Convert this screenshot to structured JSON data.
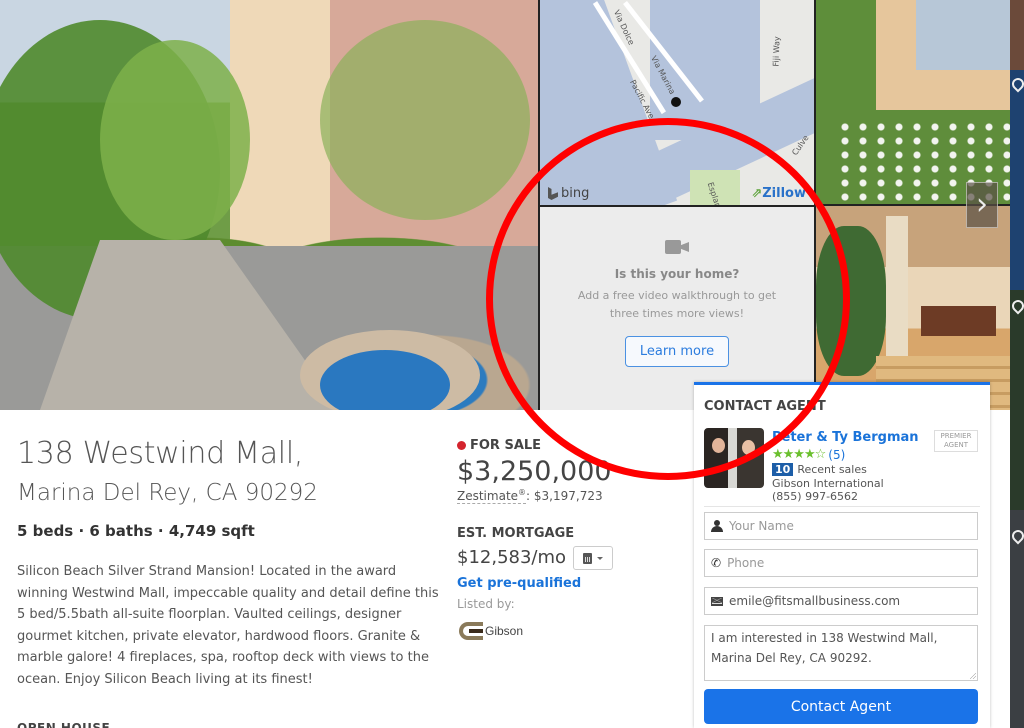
{
  "gallery": {
    "next_icon": "chevron-right-icon",
    "next_label": "›"
  },
  "map": {
    "streets": [
      "Via Dolce",
      "Via Marina",
      "Pacific Ave",
      "Fiji Way",
      "Esplan",
      "Culve"
    ],
    "provider": "bing",
    "brand": "Zillow",
    "brand_mark": "⇗"
  },
  "promo": {
    "icon": "video-camera-icon",
    "title": "Is this your home?",
    "description_line1": "Add a free video walkthrough to get",
    "description_line2": "three times more views!",
    "button_label": "Learn more"
  },
  "listing": {
    "address_line1": "138 Westwind Mall,",
    "address_line2": "Marina Del Rey, CA 90292",
    "facts": "5 beds · 6 baths · 4,749 sqft",
    "description": "Silicon Beach Silver Strand Mansion! Located in the award winning Westwind Mall, impeccable quality and detail define this 5 bed/5.5bath all-suite floorplan. Vaulted ceilings, designer gourmet kitchen, private elevator, hardwood floors. Granite & marble galore! 4 fireplaces, spa, rooftop deck with views to the ocean. Enjoy Silicon Beach living at its finest!",
    "open_house_heading": "OPEN HOUSE"
  },
  "pricing": {
    "status": "FOR SALE",
    "status_color": "#d4242e",
    "price": "$3,250,000",
    "zestimate_label": "Zestimate",
    "zestimate_reg": "®",
    "zestimate_value": ": $3,197,723",
    "mortgage_label": "EST. MORTGAGE",
    "mortgage_value": "$12,583/mo",
    "prequal_link": "Get pre-qualified",
    "listed_by_label": "Listed by:",
    "broker_logo_text": "Gibson"
  },
  "contact": {
    "title": "CONTACT AGENT",
    "agent_name": "Peter & Ty Bergman",
    "stars": "★★★★☆",
    "rating": 4.5,
    "review_count": "(5)",
    "recent_sales_count": "10",
    "recent_sales_label": "Recent sales",
    "brokerage": "Gibson International",
    "phone": "(855) 997-6562",
    "premier_badge": "PREMIER AGENT",
    "name_placeholder": "Your Name",
    "phone_placeholder": "Phone",
    "email_value": "emile@fitsmallbusiness.com",
    "message_value": "I am interested in 138 Westwind Mall, Marina Del Rey, CA 90292.",
    "submit_label": "Contact Agent",
    "accent_color": "#1a73e8"
  }
}
